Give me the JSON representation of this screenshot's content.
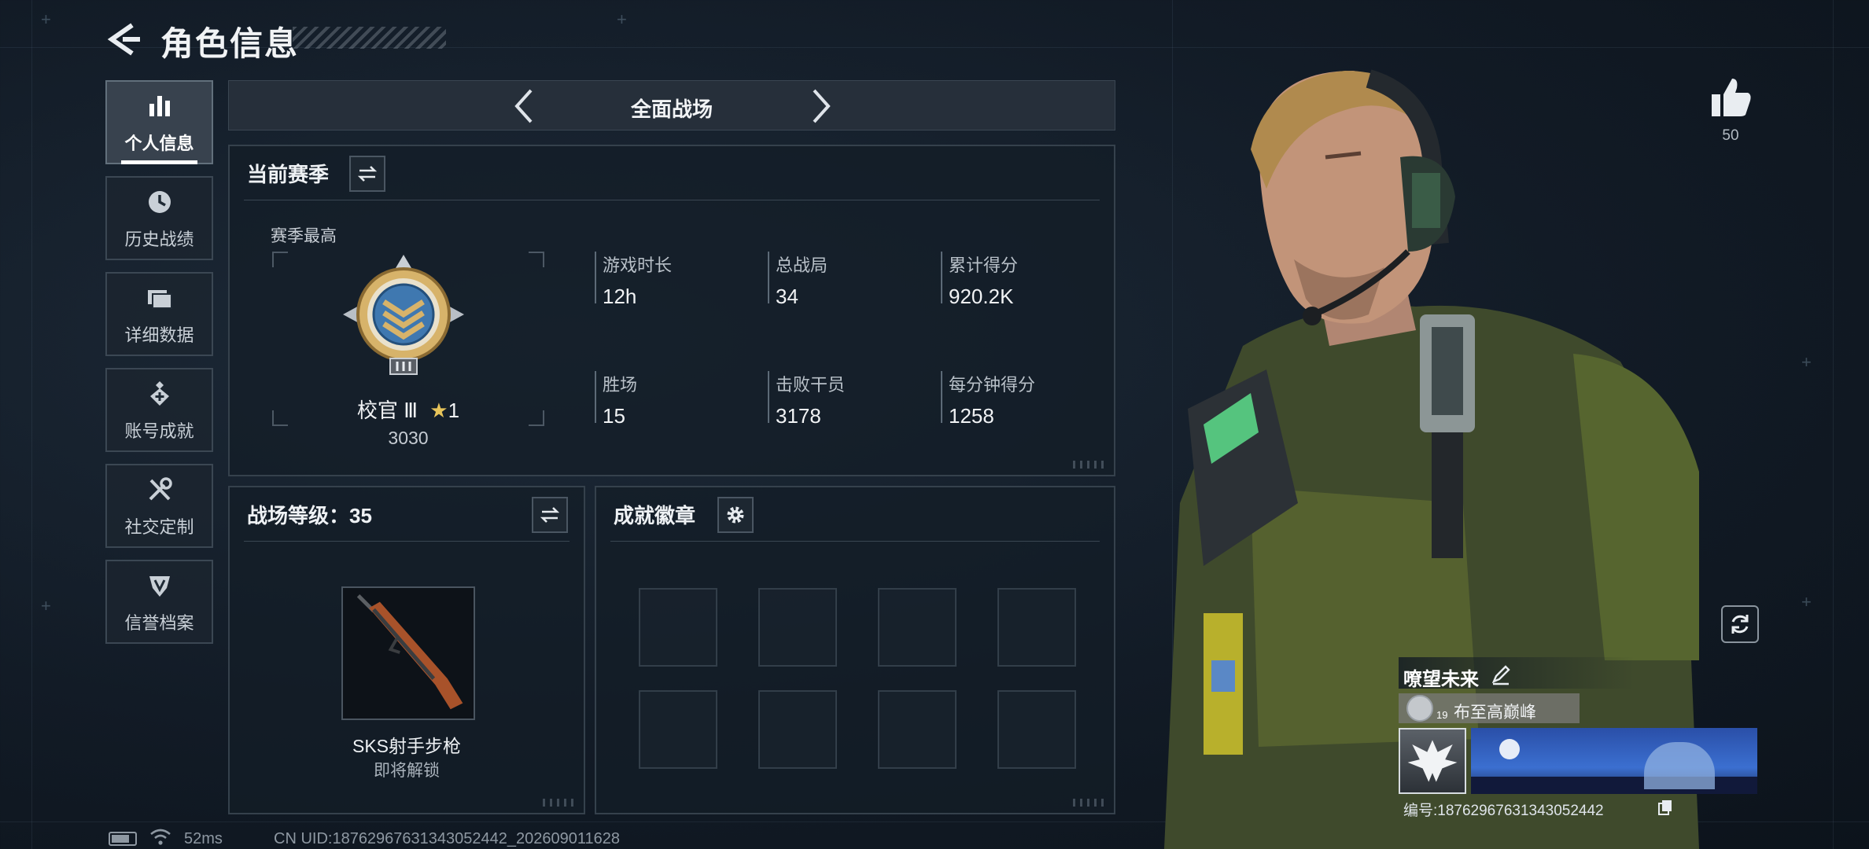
{
  "header": {
    "title": "角色信息"
  },
  "nav": {
    "items": [
      {
        "label": "个人信息",
        "icon": "bar-chart-icon",
        "active": true
      },
      {
        "label": "历史战绩",
        "icon": "clock-icon",
        "active": false
      },
      {
        "label": "详细数据",
        "icon": "folder-icon",
        "active": false
      },
      {
        "label": "账号成就",
        "icon": "medal-icon",
        "active": false
      },
      {
        "label": "社交定制",
        "icon": "tools-icon",
        "active": false
      },
      {
        "label": "信誉档案",
        "icon": "shield-icon",
        "active": false
      }
    ]
  },
  "mode": {
    "label": "全面战场"
  },
  "season": {
    "heading": "当前赛季",
    "best_label": "赛季最高",
    "rank_name": "校官 Ⅲ",
    "rank_stars": "1",
    "rank_points": "3030",
    "stats": [
      {
        "label": "游戏时长",
        "value": "12h"
      },
      {
        "label": "总战局",
        "value": "34"
      },
      {
        "label": "累计得分",
        "value": "920.2K"
      },
      {
        "label": "胜场",
        "value": "15"
      },
      {
        "label": "击败干员",
        "value": "3178"
      },
      {
        "label": "每分钟得分",
        "value": "1258"
      }
    ]
  },
  "battlefield": {
    "heading": "战场等级：35",
    "weapon_name": "SKS射手步枪",
    "weapon_status": "即将解锁"
  },
  "achievements": {
    "heading": "成就徽章",
    "slots": 8
  },
  "profile": {
    "likes": "50",
    "nickname": "嘹望未来",
    "level": "19",
    "title_text": "布至高巅峰",
    "id_text": "编号:18762967631343052442"
  },
  "status_bar": {
    "ping": "52ms",
    "uid": "CN UID:18762967631343052442_202609011628"
  },
  "colors": {
    "accent_gold": "#d7b36a",
    "rank_blue": "#3f78b0",
    "star_gold": "#e7c45a"
  }
}
